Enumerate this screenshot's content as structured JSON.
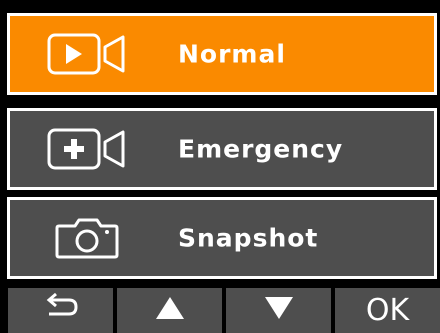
{
  "menu": {
    "items": [
      {
        "label": "Normal",
        "icon": "video-camera-icon",
        "selected": true
      },
      {
        "label": "Emergency",
        "icon": "emergency-video-icon",
        "selected": false
      },
      {
        "label": "Snapshot",
        "icon": "camera-icon",
        "selected": false
      }
    ]
  },
  "colors": {
    "selected": "#fa8a00",
    "unselected": "#4e4e4e",
    "border": "#ffffff",
    "background": "#000000"
  },
  "buttons": {
    "back_icon": "return-arrow-icon",
    "up_icon": "triangle-up-icon",
    "down_icon": "triangle-down-icon",
    "ok_label": "OK"
  }
}
